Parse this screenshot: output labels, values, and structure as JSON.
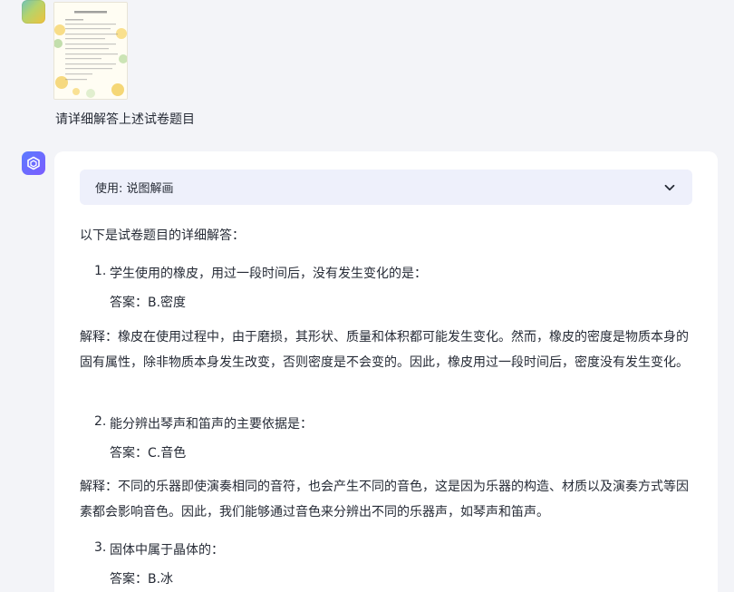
{
  "user_message": {
    "text": "请详细解答上述试卷题目"
  },
  "assistant_message": {
    "tool_label": "使用: 说图解画",
    "intro": "以下是试卷题目的详细解答：",
    "questions": [
      {
        "number": "1.",
        "question": "学生使用的橡皮，用过一段时间后，没有发生变化的是：",
        "answer": "答案：B.密度",
        "explanation": "解释：橡皮在使用过程中，由于磨损，其形状、质量和体积都可能发生变化。然而，橡皮的密度是物质本身的固有属性，除非物质本身发生改变，否则密度是不会变的。因此，橡皮用过一段时间后，密度没有发生变化。"
      },
      {
        "number": "2.",
        "question": "能分辨出琴声和笛声的主要依据是：",
        "answer": "答案：C.音色",
        "explanation": "解释：不同的乐器即使演奏相同的音符，也会产生不同的音色，这是因为乐器的构造、材质以及演奏方式等因素都会影响音色。因此，我们能够通过音色来分辨出不同的乐器声，如琴声和笛声。"
      },
      {
        "number": "3.",
        "question": "固体中属于晶体的：",
        "answer": "答案：B.冰"
      }
    ]
  },
  "colors": {
    "page_bg": "#f3f4f8",
    "card_bg": "#ffffff",
    "tool_bar_bg": "#eef0fb",
    "text": "#262b36",
    "bot_avatar": "#6366ff"
  }
}
